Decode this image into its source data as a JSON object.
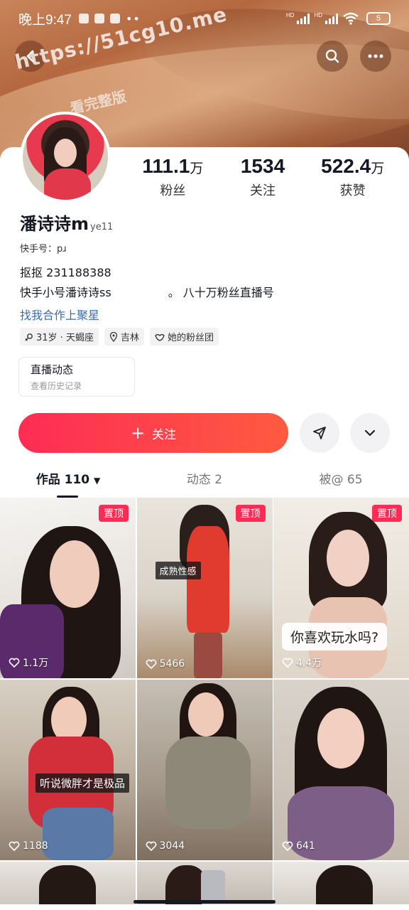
{
  "status_bar": {
    "time": "晚上9:47",
    "battery": "5",
    "signal_label": "HD"
  },
  "header": {
    "watermark": "https://51cg10.me",
    "watermark_sub": "看完整版"
  },
  "profile": {
    "name": "潘诗诗m",
    "name_suffix": "ye11",
    "account_prefix": "快手号：",
    "account_value": "pɹ",
    "bio_line1": "抠抠 231188388",
    "bio_line2": "快手小号潘诗诗ss",
    "bio_line2_tail": "。   八十万粉丝直播号",
    "link": "找我合作上聚星",
    "tags": [
      "31岁 · 天蝎座",
      "吉林",
      "她的粉丝团"
    ]
  },
  "stats": [
    {
      "num": "111.1",
      "unit": "万",
      "label": "粉丝"
    },
    {
      "num": "1534",
      "unit": "",
      "label": "关注"
    },
    {
      "num": "522.4",
      "unit": "万",
      "label": "获赞"
    }
  ],
  "live": {
    "title": "直播动态",
    "subtitle": "查看历史记录"
  },
  "actions": {
    "follow": "关注"
  },
  "tabs": [
    {
      "label": "作品 110"
    },
    {
      "label": "动态 2"
    },
    {
      "label": "被@ 65"
    }
  ],
  "videos": [
    {
      "likes": "1.1万",
      "pinned": "置顶",
      "caption": ""
    },
    {
      "likes": "5466",
      "pinned": "置顶",
      "caption": "成熟性感"
    },
    {
      "likes": "4.4万",
      "pinned": "置顶",
      "caption": "你喜欢玩水吗?"
    },
    {
      "likes": "1188",
      "pinned": "",
      "caption": "听说微胖才是极品"
    },
    {
      "likes": "3044",
      "pinned": "",
      "caption": ""
    },
    {
      "likes": "641",
      "pinned": "",
      "caption": ""
    }
  ],
  "colors": {
    "accent": "#fe2c55",
    "link": "#3a6bb3"
  }
}
